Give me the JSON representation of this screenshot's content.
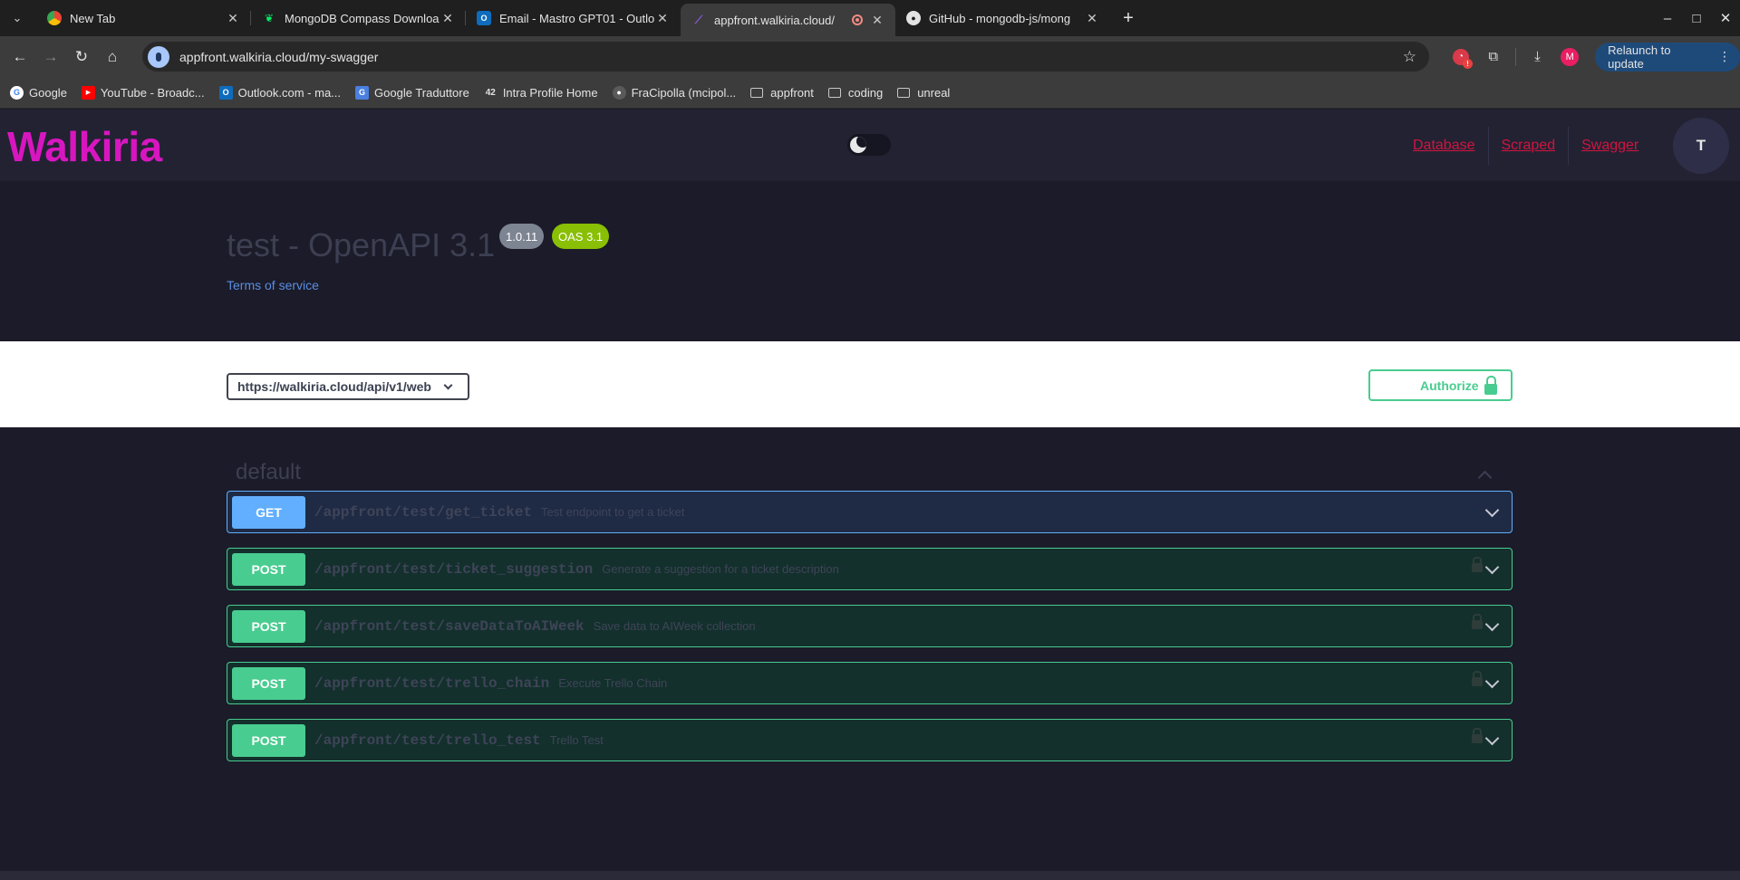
{
  "browser": {
    "tabs": [
      {
        "title": "New Tab",
        "active": false
      },
      {
        "title": "MongoDB Compass Downloa",
        "active": false
      },
      {
        "title": "Email - Mastro GPT01 - Outlo",
        "active": false
      },
      {
        "title": "appfront.walkiria.cloud/",
        "active": true
      },
      {
        "title": "GitHub - mongodb-js/mong",
        "active": false
      }
    ],
    "url": "appfront.walkiria.cloud/my-swagger",
    "relaunch_label": "Relaunch to update",
    "profile_initial": "M",
    "extension_badge": "!",
    "bookmarks": [
      {
        "label": "Google",
        "type": "site"
      },
      {
        "label": "YouTube - Broadc...",
        "type": "site"
      },
      {
        "label": "Outlook.com - ma...",
        "type": "site"
      },
      {
        "label": "Google Traduttore",
        "type": "site"
      },
      {
        "label": "Intra Profile Home",
        "type": "site"
      },
      {
        "label": "FraCipolla (mcipol...",
        "type": "site"
      },
      {
        "label": "appfront",
        "type": "folder"
      },
      {
        "label": "coding",
        "type": "folder"
      },
      {
        "label": "unreal",
        "type": "folder"
      }
    ]
  },
  "app": {
    "logo": "Walkiria",
    "nav": [
      "Database",
      "Scraped",
      "Swagger"
    ],
    "avatar_initial": "T"
  },
  "swagger": {
    "title": "test - OpenAPI 3.1",
    "version": "1.0.11",
    "oas": "OAS 3.1",
    "terms": "Terms of service",
    "server": "https://walkiria.cloud/api/v1/web",
    "authorize_label": "Authorize",
    "tag": "default",
    "operations": [
      {
        "method": "GET",
        "path": "/appfront/test/get_ticket",
        "summary": "Test endpoint to get a ticket",
        "locked": false
      },
      {
        "method": "POST",
        "path": "/appfront/test/ticket_suggestion",
        "summary": "Generate a suggestion for a ticket description",
        "locked": true
      },
      {
        "method": "POST",
        "path": "/appfront/test/saveDataToAIWeek",
        "summary": "Save data to AIWeek collection",
        "locked": true
      },
      {
        "method": "POST",
        "path": "/appfront/test/trello_chain",
        "summary": "Execute Trello Chain",
        "locked": true
      },
      {
        "method": "POST",
        "path": "/appfront/test/trello_test",
        "summary": "Trello Test",
        "locked": true
      }
    ]
  },
  "colors": {
    "get": "#61affe",
    "post": "#49cc90",
    "logo": "#d816c0",
    "nav_link": "#d2143f"
  }
}
